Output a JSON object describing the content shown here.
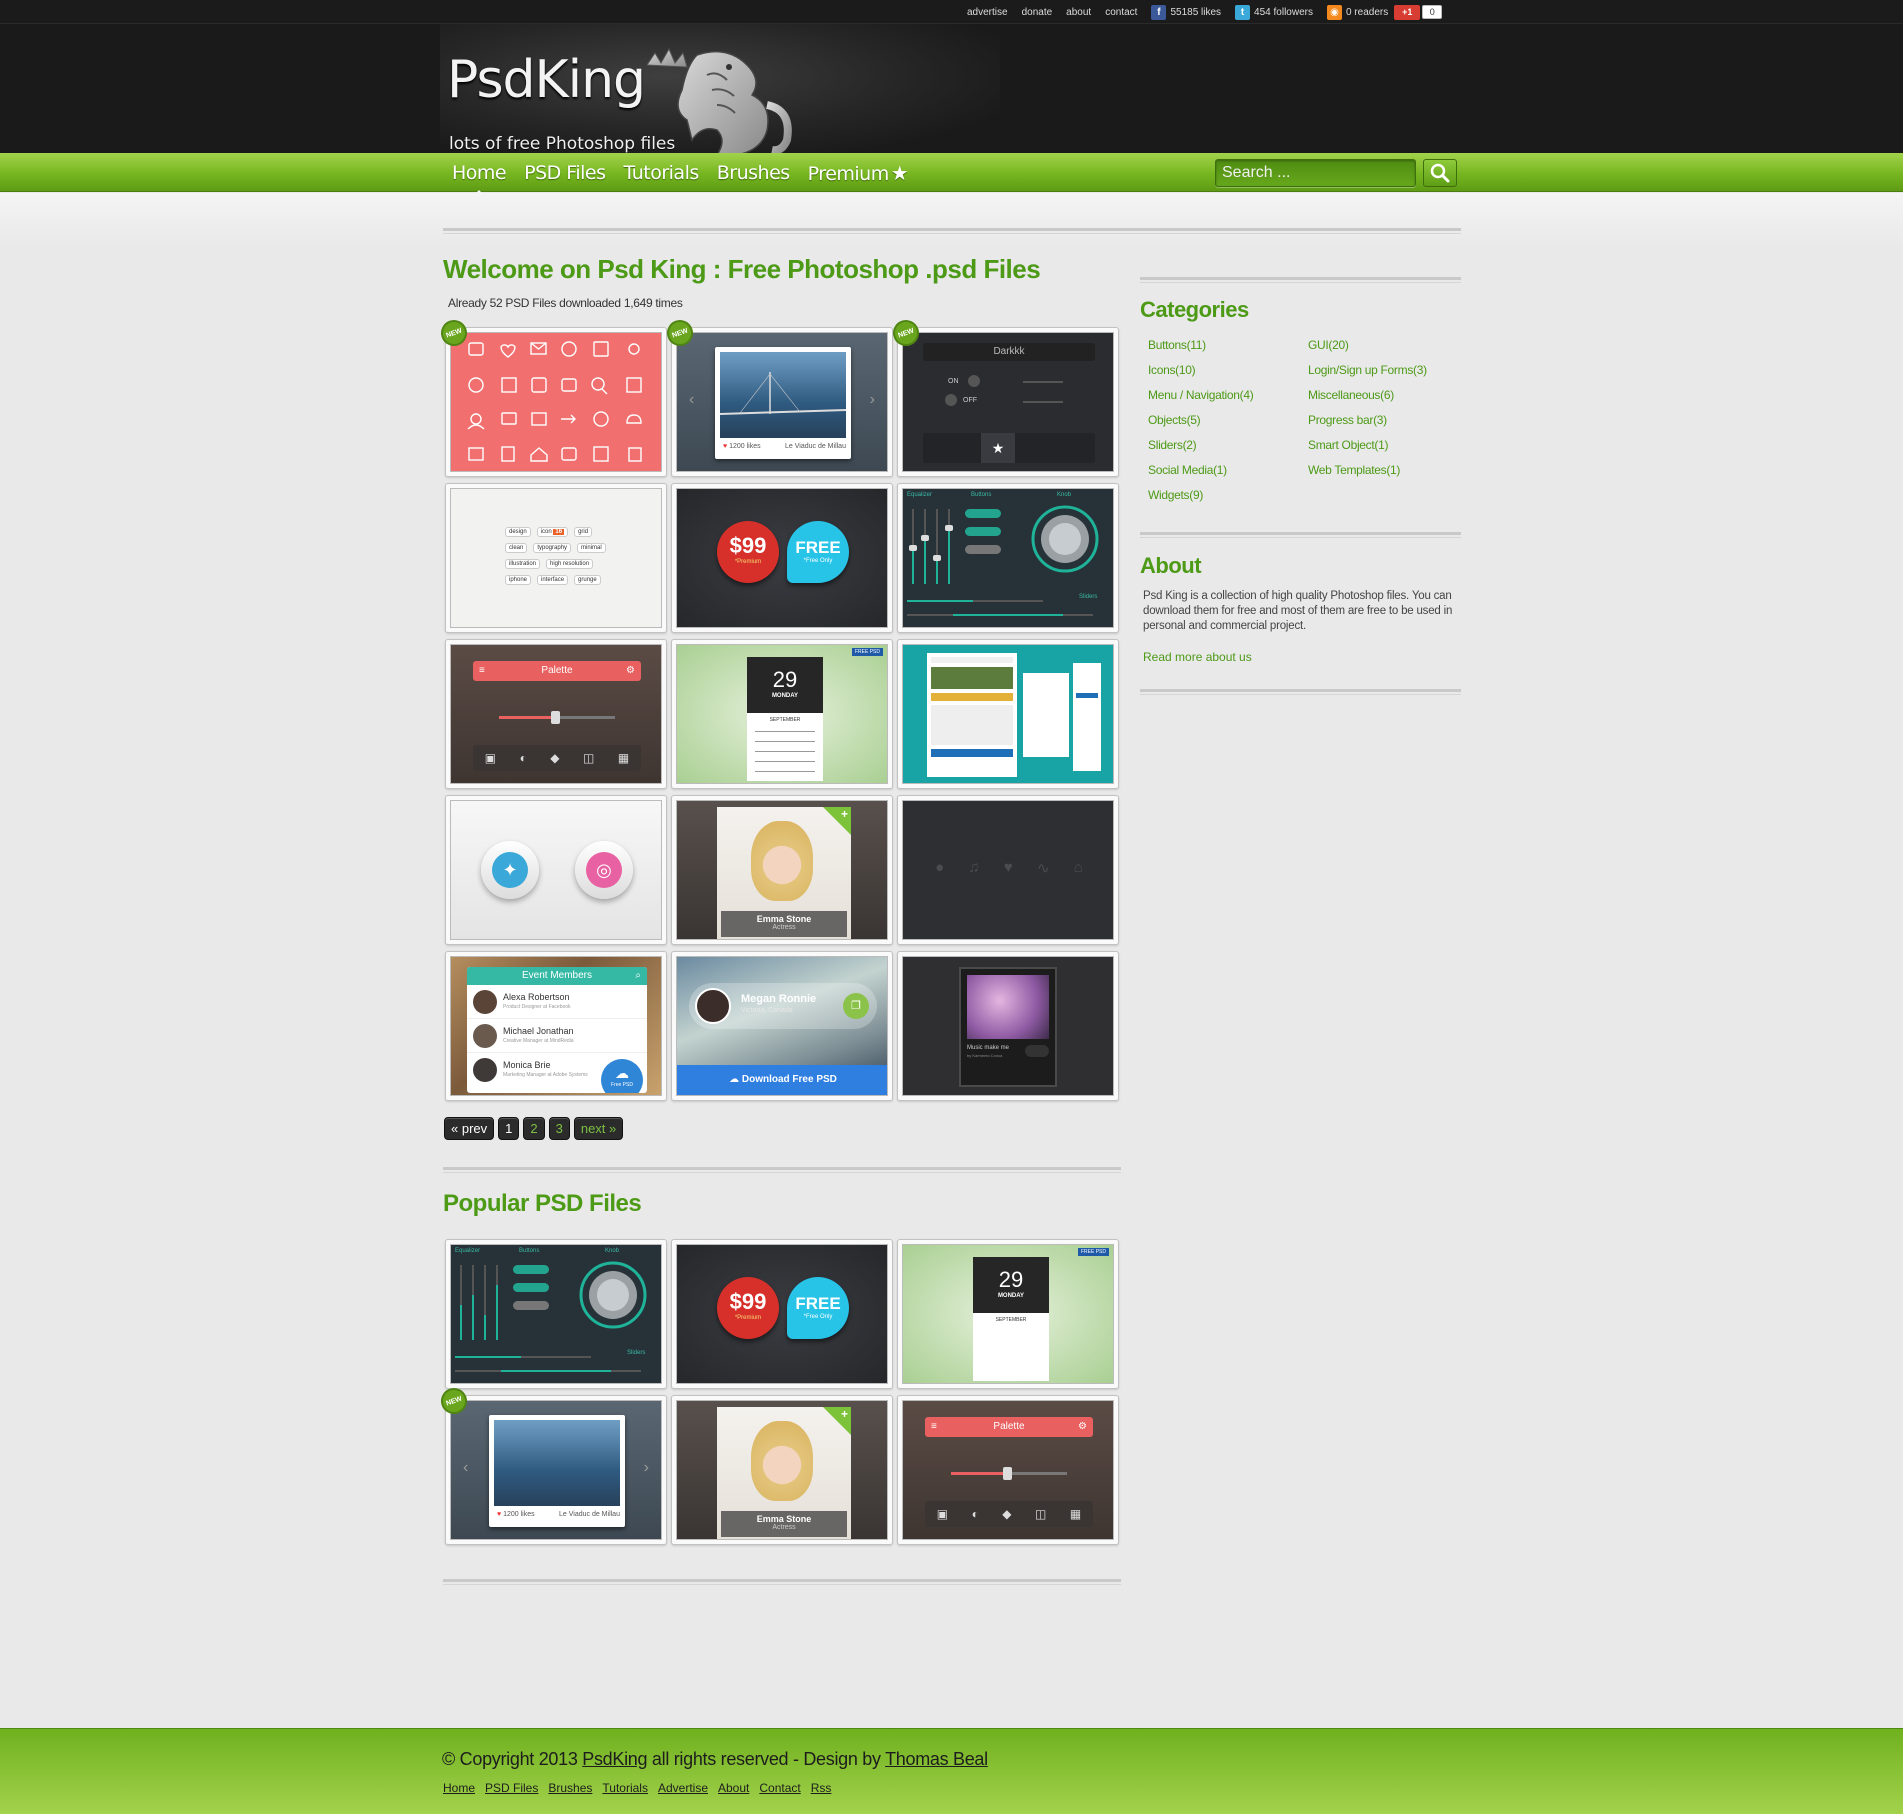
{
  "topbar": {
    "links": [
      "advertise",
      "donate",
      "about",
      "contact"
    ],
    "facebook": "55185 likes",
    "twitter": "454 followers",
    "rss": "0 readers",
    "gplus_label": "+1",
    "gplus_count": "0"
  },
  "header": {
    "logo_title": "PsdKing",
    "tagline": "lots of free Photoshop files"
  },
  "nav": {
    "items": [
      "Home",
      "PSD Files",
      "Tutorials",
      "Brushes",
      "Premium"
    ],
    "search_placeholder": "Search ..."
  },
  "main": {
    "title": "Welcome on Psd King : Free Photoshop .psd Files",
    "subtitle": "Already 52 PSD Files downloaded 1,649 times",
    "new_badge": "NEW",
    "thumb_texts": {
      "likes": "1200 likes",
      "location": "Le Viaduc de Millau",
      "darkkk": "Darkkk",
      "on": "ON",
      "off": "OFF",
      "price": "$99",
      "premium": "*Premium",
      "free": "FREE",
      "free_sub": "*Free Only",
      "palette": "Palette",
      "day": "29",
      "weekday": "MONDAY",
      "month": "SEPTEMBER",
      "free_psd_tag": "FREE PSD",
      "eq_labels": [
        "Equalizer",
        "Buttons",
        "Knob",
        "Sliders"
      ],
      "emma_name": "Emma Stone",
      "emma_role": "Actress",
      "event_title": "Event Members",
      "members": [
        {
          "name": "Alexa Robertson",
          "role": "Product Designer at Facebook"
        },
        {
          "name": "Michael Jonathan",
          "role": "Creative Manager at MindRedia"
        },
        {
          "name": "Monica Brie",
          "role": "Marketing Manager at Adobe Systems"
        }
      ],
      "free_psd_btn": "Free PSD",
      "megan_name": "Megan Ronnie",
      "megan_loc": "Victoria, Canada",
      "download_btn": "Download Free PSD",
      "music_title": "Music make me",
      "music_artist": "by Karmento Conca",
      "tags": [
        "design",
        "icon",
        "grid",
        "clean",
        "typography",
        "minimal",
        "illustration",
        "high resolution",
        "iphone",
        "interface",
        "grunge"
      ],
      "tag_badge": "16"
    },
    "pager": [
      "« prev",
      "1",
      "2",
      "3",
      "next »"
    ],
    "popular_title": "Popular PSD Files"
  },
  "sidebar": {
    "categories_title": "Categories",
    "categories_left": [
      "Buttons(11)",
      "Icons(10)",
      "Menu / Navigation(4)",
      "Objects(5)",
      "Sliders(2)",
      "Social Media(1)",
      "Widgets(9)"
    ],
    "categories_right": [
      "GUI(20)",
      "Login/Sign up Forms(3)",
      "Miscellaneous(6)",
      "Progress bar(3)",
      "Smart Object(1)",
      "Web Templates(1)"
    ],
    "about_title": "About",
    "about_text": "Psd King is a collection of high quality Photoshop files. You can download them for free and most of them are free to be used in personal and commercial project.",
    "about_link": "Read more about us"
  },
  "footer": {
    "copy_prefix": "© Copyright 2013",
    "copy_brand": "PsdKing",
    "copy_mid": "all rights reserved - Design by",
    "copy_author": "Thomas Beal",
    "links": [
      "Home",
      "PSD Files",
      "Brushes",
      "Tutorials",
      "Advertise",
      "About",
      "Contact",
      "Rss"
    ]
  },
  "colors": {
    "accent_green": "#4d9a17",
    "nav_green": "#76b620",
    "header_dark": "#1a1a1a"
  }
}
